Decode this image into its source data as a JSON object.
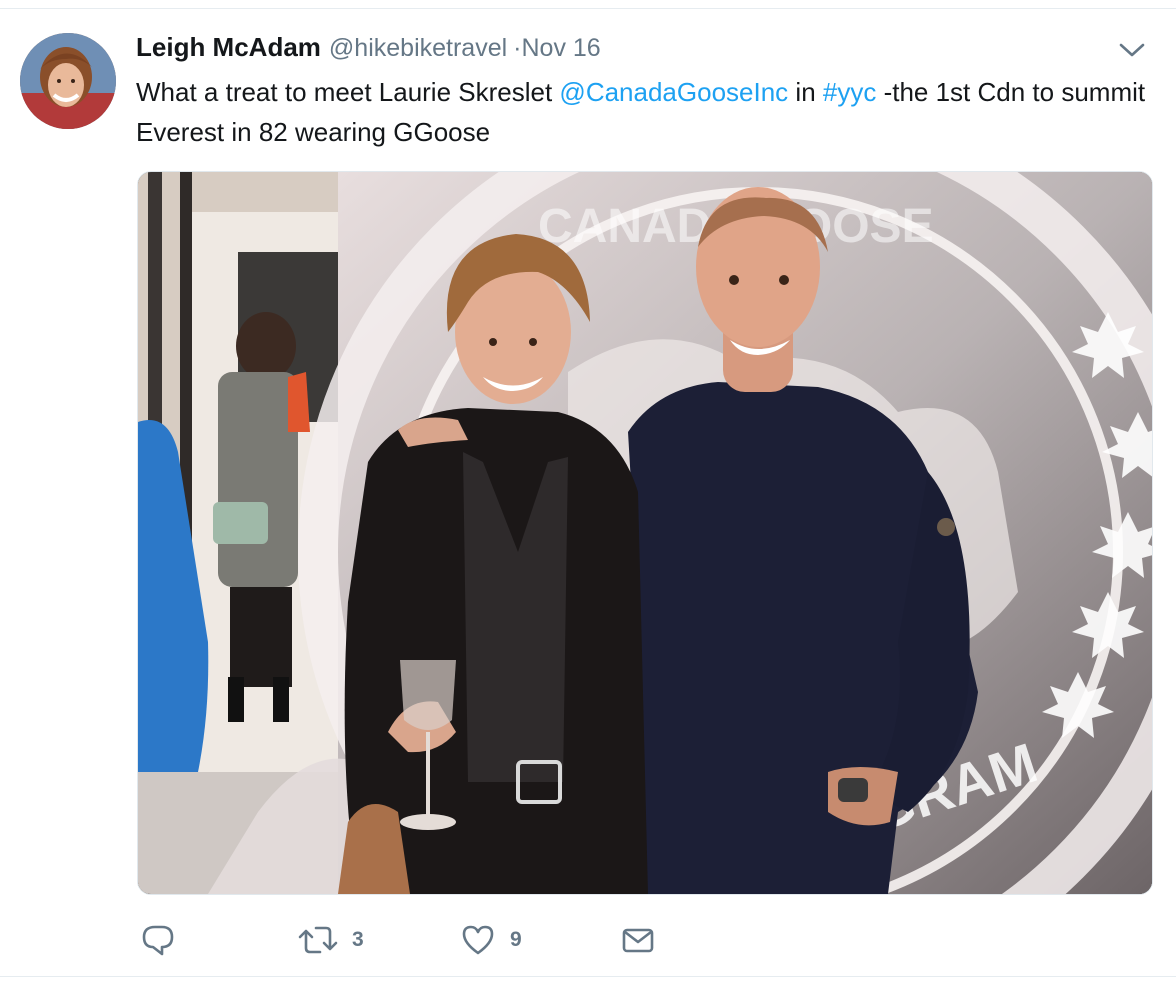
{
  "tweet": {
    "author": {
      "display_name": "Leigh McAdam",
      "screen_name": "@hikebiketravel"
    },
    "date": "·Nov 16",
    "text": {
      "part1": "What a treat to meet Laurie Skreslet ",
      "mention": "@CanadaGooseInc",
      "part2": " in ",
      "hashtag": "#yyc",
      "part3": " -the 1st Cdn to summit Everest in 82 wearing GGoose"
    },
    "media": {
      "sculpture_text_top": "CANADA GOOSE",
      "sculpture_text_bottom": "GRAM"
    },
    "actions": {
      "reply_count": "",
      "retweet_count": "3",
      "like_count": "9"
    }
  },
  "colors": {
    "link": "#1da1f2",
    "secondary_text": "#657786",
    "primary_text": "#14171a",
    "divider": "#e6ecf0"
  },
  "icons": {
    "caret": "chevron-down-icon",
    "reply": "reply-icon",
    "retweet": "retweet-icon",
    "like": "heart-icon",
    "dm": "envelope-icon"
  }
}
